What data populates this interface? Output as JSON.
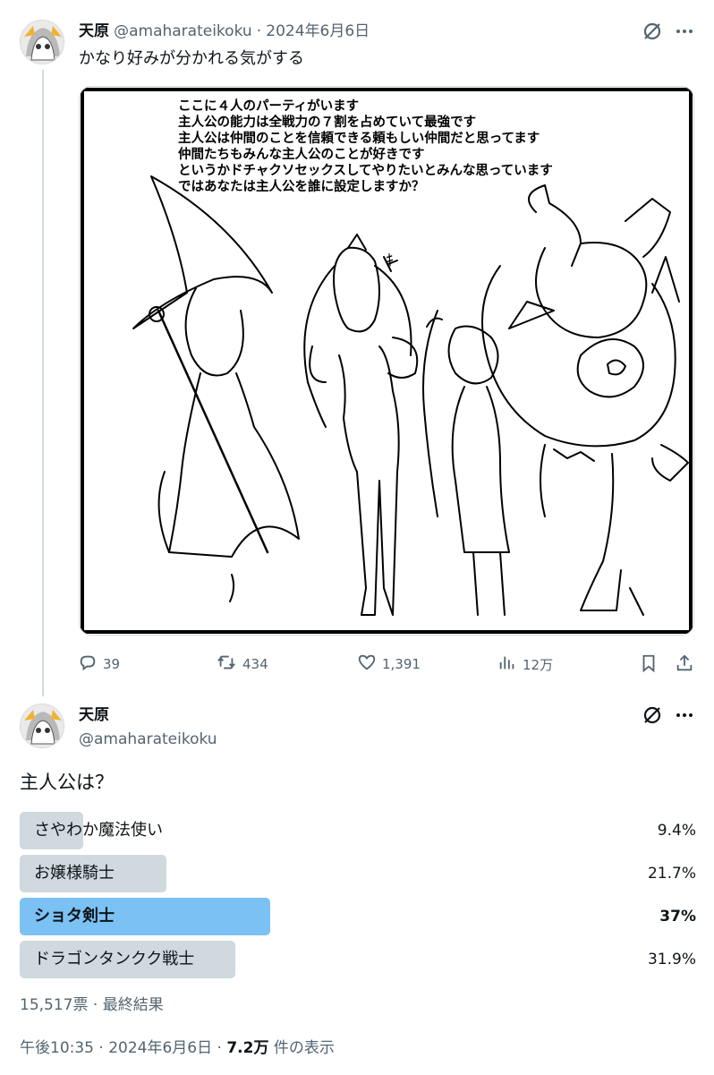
{
  "tweet1": {
    "display_name": "天原",
    "handle": "@amaharateikoku",
    "separator": "·",
    "date": "2024年6月6日",
    "text": "かなり好みが分かれる気がする",
    "media": {
      "caption_lines": [
        "ここに４人のパーティがいます",
        "主人公の能力は全戦力の７割を占めていて最強です",
        "主人公は仲間のことを信頼できる頼もしい仲間だと思ってます",
        "仲間たちもみんな主人公のことが好きです",
        "というかドチャクソセックスしてやりたいとみんな思っています",
        "ではあなたは主人公を誰に設定しますか？"
      ],
      "sfx": "ｷ"
    },
    "metrics": {
      "replies": "39",
      "reposts": "434",
      "likes": "1,391",
      "views": "12万"
    }
  },
  "tweet2": {
    "display_name": "天原",
    "handle": "@amaharateikoku",
    "text": "主人公は？",
    "poll": {
      "options": [
        {
          "label": "さやわか魔法使い",
          "percent_text": "9.4%",
          "percent": 9.4,
          "winner": false
        },
        {
          "label": "お嬢様騎士",
          "percent_text": "21.7%",
          "percent": 21.7,
          "winner": false
        },
        {
          "label": "ショタ剣士",
          "percent_text": "37%",
          "percent": 37,
          "winner": true
        },
        {
          "label": "ドラゴンタンクク戦士",
          "percent_text": "31.9%",
          "percent": 31.9,
          "winner": false
        }
      ],
      "votes": "15,517票",
      "status": "最終結果"
    },
    "footer": {
      "time": "午後10:35",
      "date": "2024年6月6日",
      "views_count": "7.2万",
      "views_suffix": "件の表示"
    }
  },
  "icons": [
    "grok-icon",
    "more-icon",
    "reply-icon",
    "repost-icon",
    "like-icon",
    "views-icon",
    "bookmark-icon",
    "share-icon"
  ],
  "colors": {
    "accent_bar": "#7bc1f4",
    "bar": "#cfd9de",
    "muted": "#536471",
    "text": "#0f1419"
  }
}
